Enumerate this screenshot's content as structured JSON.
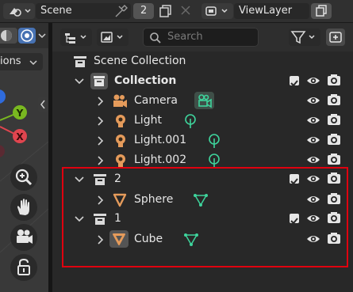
{
  "header": {
    "scene_label": "Scene",
    "scene_users": "2",
    "view_layer_label": "ViewLayer"
  },
  "viewport": {
    "menu_label": "ions",
    "axes": {
      "y": "Y",
      "x": "X"
    }
  },
  "outliner": {
    "search_placeholder": "Search",
    "root_label": "Scene Collection",
    "rows": [
      {
        "name": "Collection"
      },
      {
        "name": "Camera"
      },
      {
        "name": "Light"
      },
      {
        "name": "Light.001"
      },
      {
        "name": "Light.002"
      },
      {
        "name": "2"
      },
      {
        "name": "Sphere"
      },
      {
        "name": "1"
      },
      {
        "name": "Cube"
      }
    ]
  },
  "colors": {
    "highlight_box": "#e0000f",
    "object_orange": "#e59b5b",
    "data_green": "#3ed49c"
  }
}
